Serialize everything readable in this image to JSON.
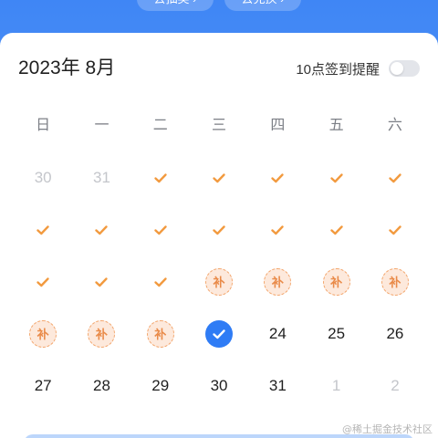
{
  "top_buttons": {
    "left": "去抽奖 ›",
    "right": "去兑换 ›"
  },
  "calendar": {
    "title": "2023年 8月",
    "reminder_label": "10点签到提醒",
    "reminder_enabled": false,
    "weekdays": [
      "日",
      "一",
      "二",
      "三",
      "四",
      "五",
      "六"
    ],
    "makeup_label": "补",
    "days": [
      {
        "label": "30",
        "state": "muted"
      },
      {
        "label": "31",
        "state": "muted"
      },
      {
        "label": "",
        "state": "checked"
      },
      {
        "label": "",
        "state": "checked"
      },
      {
        "label": "",
        "state": "checked"
      },
      {
        "label": "",
        "state": "checked"
      },
      {
        "label": "",
        "state": "checked"
      },
      {
        "label": "",
        "state": "checked"
      },
      {
        "label": "",
        "state": "checked"
      },
      {
        "label": "",
        "state": "checked"
      },
      {
        "label": "",
        "state": "checked"
      },
      {
        "label": "",
        "state": "checked"
      },
      {
        "label": "",
        "state": "checked"
      },
      {
        "label": "",
        "state": "checked"
      },
      {
        "label": "",
        "state": "checked"
      },
      {
        "label": "",
        "state": "checked"
      },
      {
        "label": "",
        "state": "checked"
      },
      {
        "label": "",
        "state": "makeup"
      },
      {
        "label": "",
        "state": "makeup"
      },
      {
        "label": "",
        "state": "makeup"
      },
      {
        "label": "",
        "state": "makeup"
      },
      {
        "label": "",
        "state": "makeup"
      },
      {
        "label": "",
        "state": "makeup"
      },
      {
        "label": "",
        "state": "makeup"
      },
      {
        "label": "",
        "state": "today"
      },
      {
        "label": "24",
        "state": "normal"
      },
      {
        "label": "25",
        "state": "normal"
      },
      {
        "label": "26",
        "state": "normal"
      },
      {
        "label": "27",
        "state": "normal"
      },
      {
        "label": "28",
        "state": "normal"
      },
      {
        "label": "29",
        "state": "normal"
      },
      {
        "label": "30",
        "state": "normal"
      },
      {
        "label": "31",
        "state": "normal"
      },
      {
        "label": "1",
        "state": "muted"
      },
      {
        "label": "2",
        "state": "muted"
      }
    ]
  },
  "colors": {
    "check": "#f29a3f",
    "today": "#2f7cf5",
    "makeup_border": "#f3a56b"
  },
  "watermark": "@稀土掘金技术社区"
}
